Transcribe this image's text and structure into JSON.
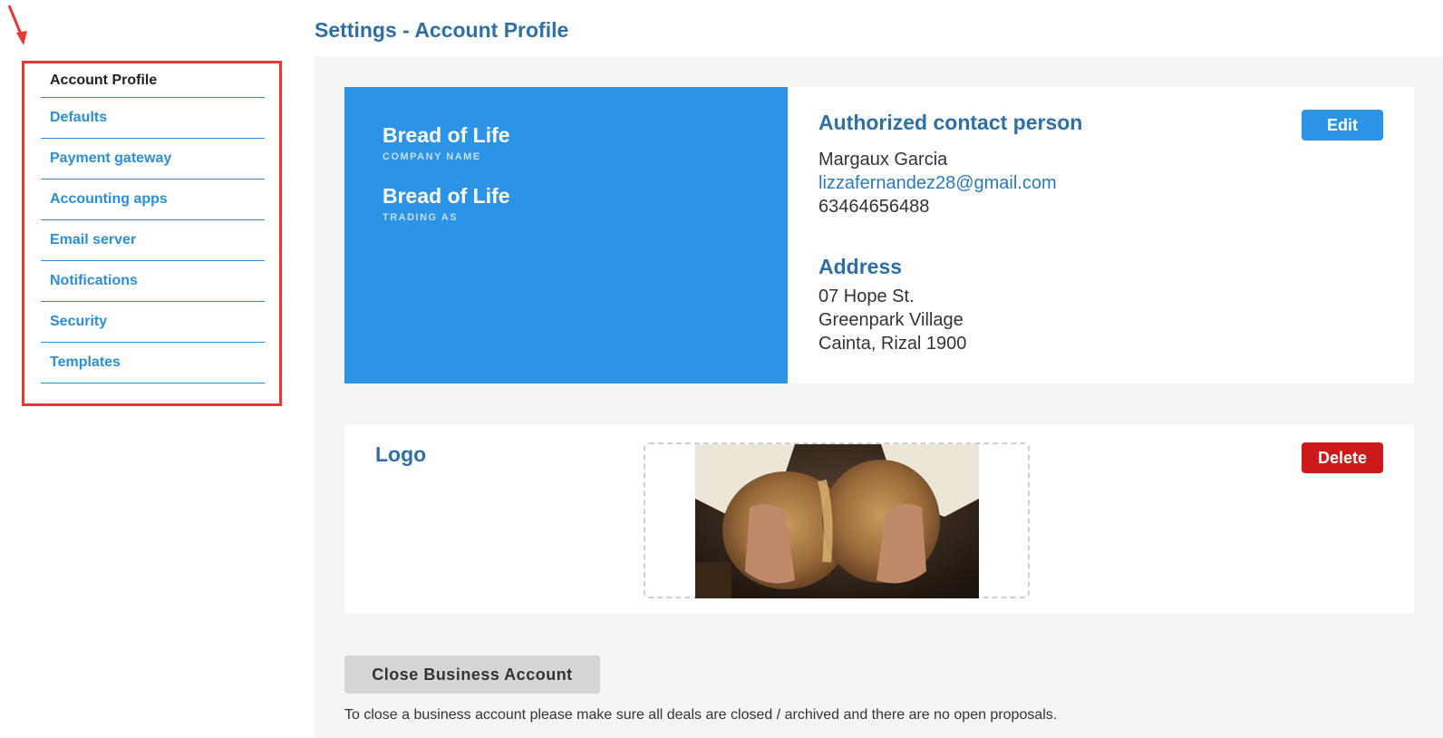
{
  "page": {
    "title": "Settings - Account Profile"
  },
  "sidebar": {
    "items": [
      {
        "label": "Account Profile",
        "active": true
      },
      {
        "label": "Defaults"
      },
      {
        "label": "Payment gateway"
      },
      {
        "label": "Accounting apps"
      },
      {
        "label": "Email server"
      },
      {
        "label": "Notifications"
      },
      {
        "label": "Security"
      },
      {
        "label": "Templates"
      }
    ]
  },
  "company": {
    "name": "Bread of Life",
    "name_caption": "COMPANY NAME",
    "trading_as": "Bread of Life",
    "trading_caption": "TRADING AS"
  },
  "contact": {
    "heading": "Authorized contact person",
    "name": "Margaux Garcia",
    "email": "lizzafernandez28@gmail.com",
    "phone": "63464656488",
    "edit_label": "Edit"
  },
  "address": {
    "heading": "Address",
    "line1": "07 Hope St.",
    "line2": "Greenpark Village",
    "line3": "Cainta, Rizal 1900"
  },
  "logo": {
    "heading": "Logo",
    "delete_label": "Delete"
  },
  "account": {
    "close_label": "Close Business Account",
    "close_note": "To close a business account please make sure all deals are closed / archived and there are no open proposals."
  },
  "colors": {
    "accent": "#2b94e6",
    "heading": "#2d6fa8",
    "danger": "#cc1a1a",
    "annotation": "#e53935"
  }
}
